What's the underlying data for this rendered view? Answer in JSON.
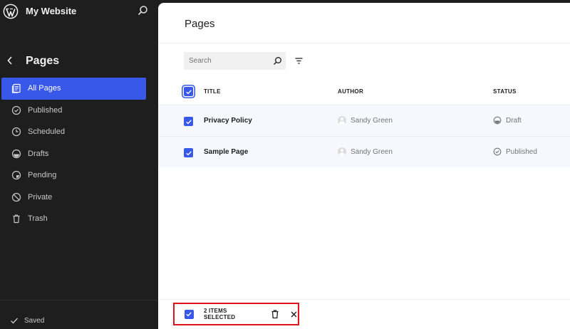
{
  "site": {
    "name": "My Website"
  },
  "sidebar": {
    "section_title": "Pages",
    "items": [
      {
        "label": "All Pages",
        "icon": "pages-icon",
        "active": true
      },
      {
        "label": "Published",
        "icon": "published-icon"
      },
      {
        "label": "Scheduled",
        "icon": "scheduled-icon"
      },
      {
        "label": "Drafts",
        "icon": "drafts-icon"
      },
      {
        "label": "Pending",
        "icon": "pending-icon"
      },
      {
        "label": "Private",
        "icon": "private-icon"
      },
      {
        "label": "Trash",
        "icon": "trash-icon"
      }
    ],
    "footer_status": "Saved"
  },
  "main": {
    "title": "Pages",
    "search": {
      "placeholder": "Search",
      "value": ""
    },
    "table": {
      "columns": [
        "TITLE",
        "AUTHOR",
        "STATUS"
      ],
      "rows": [
        {
          "title": "Privacy Policy",
          "author": "Sandy Green",
          "status": "Draft",
          "selected": true
        },
        {
          "title": "Sample Page",
          "author": "Sandy Green",
          "status": "Published",
          "selected": true
        }
      ]
    },
    "bulk": {
      "label": "2 ITEMS SELECTED"
    }
  },
  "colors": {
    "accent": "#3858e9",
    "sidebar_bg": "#1e1e1e",
    "highlight_border": "#e0131a"
  }
}
